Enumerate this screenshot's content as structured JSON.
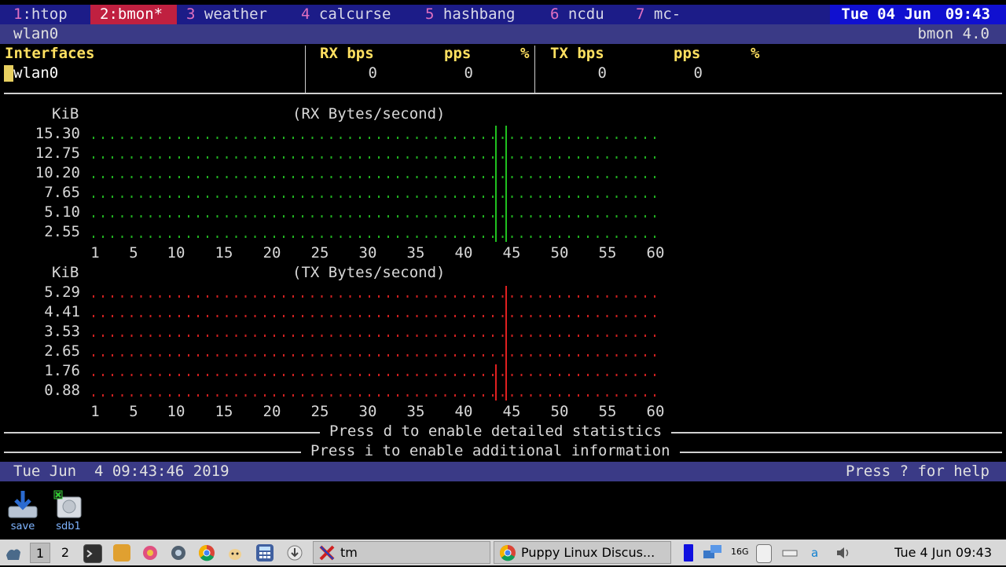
{
  "tmux": {
    "tabs": [
      {
        "num": "1",
        "name": ":htop",
        "active": false
      },
      {
        "num": "2",
        "name": ":bmon*",
        "active": true
      },
      {
        "num": "3",
        "name": " weather",
        "active": false
      },
      {
        "num": "4",
        "name": " calcurse",
        "active": false
      },
      {
        "num": "5",
        "name": " hashbang",
        "active": false
      },
      {
        "num": "6",
        "name": " ncdu",
        "active": false
      },
      {
        "num": "7",
        "name": " mc-",
        "active": false
      }
    ],
    "date": "Tue 04 Jun",
    "time": "09:43"
  },
  "bmon": {
    "interface_title": "wlan0",
    "version": "bmon 4.0",
    "headers": {
      "interfaces": "Interfaces",
      "rx_bps": "RX bps",
      "rx_pps": "pps",
      "rx_pct": "%",
      "tx_bps": "TX bps",
      "tx_pps": "pps",
      "tx_pct": "%"
    },
    "row": {
      "name": "wlan0",
      "rx_bps": "0",
      "rx_pps": "0",
      "tx_bps": "0",
      "tx_pps": "0"
    },
    "rx_graph": {
      "unit": "KiB",
      "title": "(RX Bytes/second)",
      "y_labels": [
        "15.30",
        "12.75",
        "10.20",
        "7.65",
        "5.10",
        "2.55"
      ],
      "x_labels": [
        "1",
        "5",
        "10",
        "15",
        "20",
        "25",
        "30",
        "35",
        "40",
        "45",
        "50",
        "55",
        "60"
      ],
      "color": "#20c020"
    },
    "tx_graph": {
      "unit": "KiB",
      "title": "(TX Bytes/second)",
      "y_labels": [
        "5.29",
        "4.41",
        "3.53",
        "2.65",
        "1.76",
        "0.88"
      ],
      "x_labels": [
        "1",
        "5",
        "10",
        "15",
        "20",
        "25",
        "30",
        "35",
        "40",
        "45",
        "50",
        "55",
        "60"
      ],
      "color": "#e02020"
    },
    "hint_detailed": "Press d to enable detailed statistics",
    "hint_info": "Press i to enable additional information",
    "status_time": "Tue Jun  4 09:43:46 2019",
    "help": "Press ? for help"
  },
  "desktop": {
    "icons": [
      {
        "name": "save-icon",
        "label": "save"
      },
      {
        "name": "drive-icon",
        "label": "sdb1"
      }
    ]
  },
  "taskbar": {
    "workspaces": [
      "1",
      "2"
    ],
    "tasks": [
      {
        "name": "terminal-task",
        "label": "tm"
      },
      {
        "name": "browser-task",
        "label": "Puppy Linux Discus..."
      }
    ],
    "memory_label": "16G",
    "clock": "Tue 4 Jun 09:43"
  }
}
